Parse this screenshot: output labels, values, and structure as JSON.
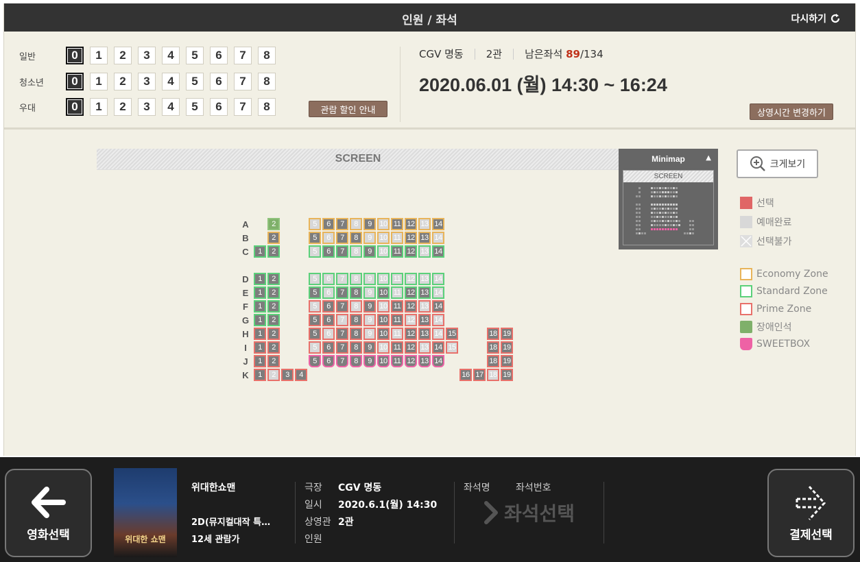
{
  "header": {
    "title": "인원 / 좌석",
    "reset_label": "다시하기"
  },
  "people": {
    "numbers": [
      "0",
      "1",
      "2",
      "3",
      "4",
      "5",
      "6",
      "7",
      "8"
    ],
    "selected": "0",
    "rows": [
      {
        "label": "일반"
      },
      {
        "label": "청소년"
      },
      {
        "label": "우대"
      }
    ],
    "discount_button": "관람 할인 안내"
  },
  "info": {
    "theater": "CGV 명동",
    "hall": "2관",
    "remaining_label": "남은좌석",
    "remaining_count": "89",
    "total": "/134",
    "datetime": "2020.06.01 (월) 14:30 ~ 16:24",
    "change_time_button": "상영시간 변경하기"
  },
  "screen": {
    "label": "SCREEN"
  },
  "minimap": {
    "title": "Minimap",
    "screen_label": "SCREEN"
  },
  "zoom": {
    "label": "크게보기"
  },
  "legend": {
    "status": [
      {
        "label": "선택",
        "color": "#e06666"
      },
      {
        "label": "예매완료",
        "color": "#d8d8d8"
      },
      {
        "label": "선택불가",
        "color": "#e8e8e8"
      }
    ],
    "zones": [
      {
        "label": "Economy Zone",
        "color": "#e8b45a"
      },
      {
        "label": "Standard Zone",
        "color": "#5bd07a"
      },
      {
        "label": "Prime Zone",
        "color": "#e8706a"
      },
      {
        "label": "장애인석",
        "color": "#7fb06a"
      },
      {
        "label": "SWEETBOX",
        "color": "#ee62a5"
      }
    ]
  },
  "seat_map": {
    "rows": [
      {
        "row": "A",
        "seats": [
          [
            2,
            "d",
            "a"
          ],
          [
            5,
            "e",
            "s"
          ],
          [
            6,
            "e",
            "a"
          ],
          [
            7,
            "e",
            "a"
          ],
          [
            8,
            "e",
            "s"
          ],
          [
            9,
            "e",
            "a"
          ],
          [
            10,
            "e",
            "s"
          ],
          [
            11,
            "e",
            "a"
          ],
          [
            12,
            "e",
            "a"
          ],
          [
            13,
            "e",
            "s"
          ],
          [
            14,
            "e",
            "a"
          ]
        ]
      },
      {
        "row": "B",
        "seats": [
          [
            2,
            "e",
            "a"
          ],
          [
            5,
            "e",
            "a"
          ],
          [
            6,
            "e",
            "s"
          ],
          [
            7,
            "e",
            "a"
          ],
          [
            8,
            "e",
            "a"
          ],
          [
            9,
            "e",
            "s"
          ],
          [
            10,
            "e",
            "s"
          ],
          [
            11,
            "e",
            "s"
          ],
          [
            12,
            "e",
            "a"
          ],
          [
            13,
            "e",
            "a"
          ],
          [
            14,
            "e",
            "s"
          ]
        ]
      },
      {
        "row": "C",
        "seats": [
          [
            1,
            "s",
            "a"
          ],
          [
            2,
            "s",
            "a"
          ],
          [
            5,
            "s",
            "s"
          ],
          [
            6,
            "s",
            "a"
          ],
          [
            7,
            "s",
            "a"
          ],
          [
            8,
            "s",
            "s"
          ],
          [
            9,
            "s",
            "a"
          ],
          [
            10,
            "s",
            "s"
          ],
          [
            11,
            "s",
            "a"
          ],
          [
            12,
            "s",
            "a"
          ],
          [
            13,
            "s",
            "s"
          ],
          [
            14,
            "s",
            "a"
          ]
        ]
      },
      {
        "row": "D",
        "seats": [
          [
            1,
            "s",
            "a"
          ],
          [
            2,
            "s",
            "a"
          ],
          [
            5,
            "s",
            "s"
          ],
          [
            6,
            "s",
            "s"
          ],
          [
            7,
            "s",
            "s"
          ],
          [
            8,
            "s",
            "s"
          ],
          [
            9,
            "s",
            "s"
          ],
          [
            10,
            "s",
            "s"
          ],
          [
            11,
            "s",
            "s"
          ],
          [
            12,
            "s",
            "s"
          ],
          [
            13,
            "s",
            "s"
          ],
          [
            14,
            "s",
            "s"
          ]
        ]
      },
      {
        "row": "E",
        "seats": [
          [
            1,
            "s",
            "a"
          ],
          [
            2,
            "s",
            "a"
          ],
          [
            5,
            "s",
            "a"
          ],
          [
            6,
            "s",
            "s"
          ],
          [
            7,
            "s",
            "a"
          ],
          [
            8,
            "s",
            "a"
          ],
          [
            9,
            "s",
            "s"
          ],
          [
            10,
            "s",
            "a"
          ],
          [
            11,
            "s",
            "s"
          ],
          [
            12,
            "s",
            "a"
          ],
          [
            13,
            "s",
            "a"
          ],
          [
            14,
            "s",
            "s"
          ]
        ]
      },
      {
        "row": "F",
        "seats": [
          [
            1,
            "s",
            "a"
          ],
          [
            2,
            "s",
            "a"
          ],
          [
            5,
            "p",
            "s"
          ],
          [
            6,
            "p",
            "a"
          ],
          [
            7,
            "p",
            "a"
          ],
          [
            8,
            "p",
            "s"
          ],
          [
            9,
            "p",
            "a"
          ],
          [
            10,
            "p",
            "s"
          ],
          [
            11,
            "p",
            "a"
          ],
          [
            12,
            "p",
            "a"
          ],
          [
            13,
            "p",
            "s"
          ],
          [
            14,
            "p",
            "a"
          ]
        ]
      },
      {
        "row": "G",
        "seats": [
          [
            1,
            "s",
            "a"
          ],
          [
            2,
            "s",
            "a"
          ],
          [
            5,
            "p",
            "a"
          ],
          [
            6,
            "p",
            "a"
          ],
          [
            7,
            "p",
            "s"
          ],
          [
            8,
            "p",
            "a"
          ],
          [
            9,
            "p",
            "s"
          ],
          [
            10,
            "p",
            "a"
          ],
          [
            11,
            "p",
            "a"
          ],
          [
            12,
            "p",
            "s"
          ],
          [
            13,
            "p",
            "a"
          ],
          [
            14,
            "p",
            "s"
          ]
        ]
      },
      {
        "row": "H",
        "seats": [
          [
            1,
            "p",
            "a"
          ],
          [
            2,
            "p",
            "a"
          ],
          [
            5,
            "p",
            "a"
          ],
          [
            6,
            "p",
            "s"
          ],
          [
            7,
            "p",
            "a"
          ],
          [
            8,
            "p",
            "a"
          ],
          [
            9,
            "p",
            "s"
          ],
          [
            10,
            "p",
            "a"
          ],
          [
            11,
            "p",
            "s"
          ],
          [
            12,
            "p",
            "a"
          ],
          [
            13,
            "p",
            "a"
          ],
          [
            14,
            "p",
            "s"
          ],
          [
            15,
            "p",
            "a"
          ],
          [
            18,
            "p",
            "a"
          ],
          [
            19,
            "p",
            "a"
          ]
        ]
      },
      {
        "row": "I",
        "seats": [
          [
            1,
            "p",
            "a"
          ],
          [
            2,
            "p",
            "a"
          ],
          [
            5,
            "p",
            "s"
          ],
          [
            6,
            "p",
            "a"
          ],
          [
            7,
            "p",
            "a"
          ],
          [
            8,
            "p",
            "a"
          ],
          [
            9,
            "p",
            "a"
          ],
          [
            10,
            "p",
            "s"
          ],
          [
            11,
            "p",
            "a"
          ],
          [
            12,
            "p",
            "a"
          ],
          [
            13,
            "p",
            "s"
          ],
          [
            14,
            "p",
            "a"
          ],
          [
            15,
            "p",
            "s"
          ],
          [
            18,
            "p",
            "a"
          ],
          [
            19,
            "p",
            "a"
          ]
        ]
      },
      {
        "row": "J",
        "seats": [
          [
            1,
            "p",
            "a"
          ],
          [
            2,
            "p",
            "a"
          ],
          [
            5,
            "b",
            "a"
          ],
          [
            6,
            "b",
            "a"
          ],
          [
            7,
            "b",
            "a"
          ],
          [
            8,
            "b",
            "a"
          ],
          [
            9,
            "b",
            "a"
          ],
          [
            10,
            "b",
            "a"
          ],
          [
            11,
            "b",
            "a"
          ],
          [
            12,
            "b",
            "a"
          ],
          [
            13,
            "b",
            "a"
          ],
          [
            14,
            "b",
            "a"
          ],
          [
            18,
            "p",
            "a"
          ],
          [
            19,
            "p",
            "a"
          ]
        ]
      },
      {
        "row": "K",
        "seats": [
          [
            1,
            "p",
            "a"
          ],
          [
            2,
            "p",
            "s"
          ],
          [
            3,
            "p",
            "a"
          ],
          [
            4,
            "p",
            "a"
          ],
          [
            16,
            "p",
            "a"
          ],
          [
            17,
            "p",
            "a"
          ],
          [
            18,
            "p",
            "s"
          ],
          [
            19,
            "p",
            "a"
          ]
        ]
      }
    ]
  },
  "footer": {
    "prev_label": "영화선택",
    "next_label": "결제선택",
    "poster_text": "위대한 쇼맨",
    "movie_title": "위대한쇼맨",
    "movie_format": "2D(뮤지컬대작 특…",
    "movie_rating": "12세 관람가",
    "theater_key": "극장",
    "theater_val": "CGV 명동",
    "date_key": "일시",
    "date_val": "2020.6.1(월) 14:30",
    "hall_key": "상영관",
    "hall_val": "2관",
    "people_key": "인원",
    "seat_name_key": "좌석명",
    "seat_num_key": "좌석번호",
    "seat_select_label": "좌석선택"
  }
}
